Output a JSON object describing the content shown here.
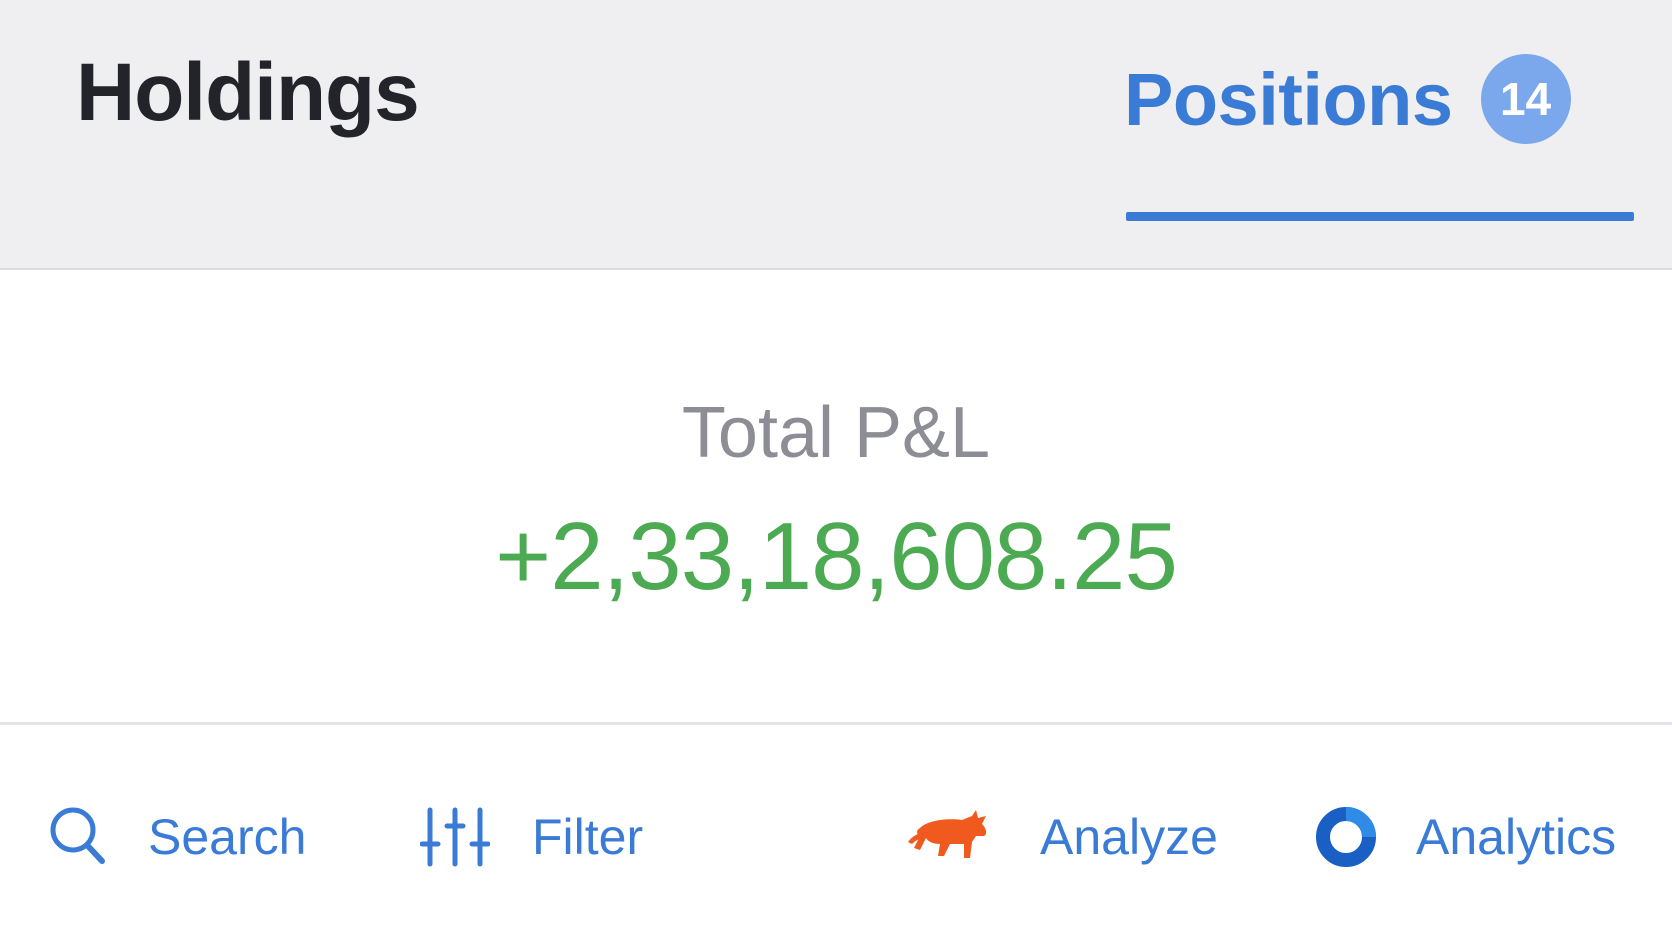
{
  "tabs": {
    "holdings": {
      "label": "Holdings"
    },
    "positions": {
      "label": "Positions",
      "count": "14"
    }
  },
  "summary": {
    "label": "Total P&L",
    "value": "+2,33,18,608.25"
  },
  "toolbar": {
    "search": {
      "label": "Search",
      "icon": "search-icon"
    },
    "filter": {
      "label": "Filter",
      "icon": "sliders-icon"
    },
    "analyze": {
      "label": "Analyze",
      "icon": "bull-icon"
    },
    "analytics": {
      "label": "Analytics",
      "icon": "ring-icon"
    }
  },
  "colors": {
    "accent": "#3a7bd5",
    "badge": "#7ba8ec",
    "profit": "#4caa52",
    "bull": "#f05a1e",
    "ring": "#1a5fc4"
  }
}
